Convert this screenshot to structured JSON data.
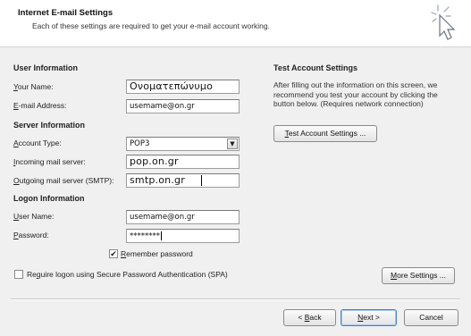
{
  "header": {
    "title": "Internet E-mail Settings",
    "subtitle": "Each of these settings are required to get your e-mail account working."
  },
  "user_info": {
    "heading": "User Information",
    "your_name_label": {
      "pre": "",
      "key": "Y",
      "post": "our Name:"
    },
    "your_name_value": "Ονοματεπώνυμο",
    "email_label": {
      "pre": "",
      "key": "E",
      "post": "-mail Address:"
    },
    "email_value": "usemame@on.gr"
  },
  "server_info": {
    "heading": "Server Information",
    "account_type_label": {
      "pre": "",
      "key": "A",
      "post": "ccount Type:"
    },
    "account_type_value": "POP3",
    "incoming_label": {
      "pre": "",
      "key": "I",
      "post": "ncoming mail server:"
    },
    "incoming_value": "pop.on.gr",
    "outgoing_label": {
      "pre": "",
      "key": "O",
      "post": "utgoing mail server (SMTP):"
    },
    "outgoing_value": "smtp.on.gr"
  },
  "logon_info": {
    "heading": "Logon Information",
    "username_label": {
      "pre": "",
      "key": "U",
      "post": "ser Name:"
    },
    "username_value": "usemame@on.gr",
    "password_label": {
      "pre": "",
      "key": "P",
      "post": "assword:"
    },
    "password_value": "********",
    "remember_label": {
      "pre": "",
      "key": "R",
      "post": "emember password"
    },
    "remember_checked": true,
    "remember_check_glyph": "✔",
    "spa_label": {
      "pre": "Re",
      "key": "q",
      "post": "uire logon using Secure Password Authentication (SPA)"
    },
    "spa_checked": false
  },
  "test_settings": {
    "heading": "Test Account Settings",
    "description": "After filling out the information on this screen, we recommend you test your account by clicking the button below. (Requires network connection)",
    "button": {
      "pre": "",
      "key": "T",
      "post": "est Account Settings ..."
    }
  },
  "more_settings_button": {
    "pre": "",
    "key": "M",
    "post": "ore Settings ..."
  },
  "footer": {
    "back_button": {
      "pre": "< ",
      "key": "B",
      "post": "ack"
    },
    "next_button": {
      "pre": "",
      "key": "N",
      "post": "ext >"
    },
    "cancel_button": {
      "pre": "Cancel",
      "key": "",
      "post": ""
    }
  },
  "icons": {
    "wizard": "cursor-sparkle-icon",
    "dropdown": "chevron-down-icon"
  }
}
